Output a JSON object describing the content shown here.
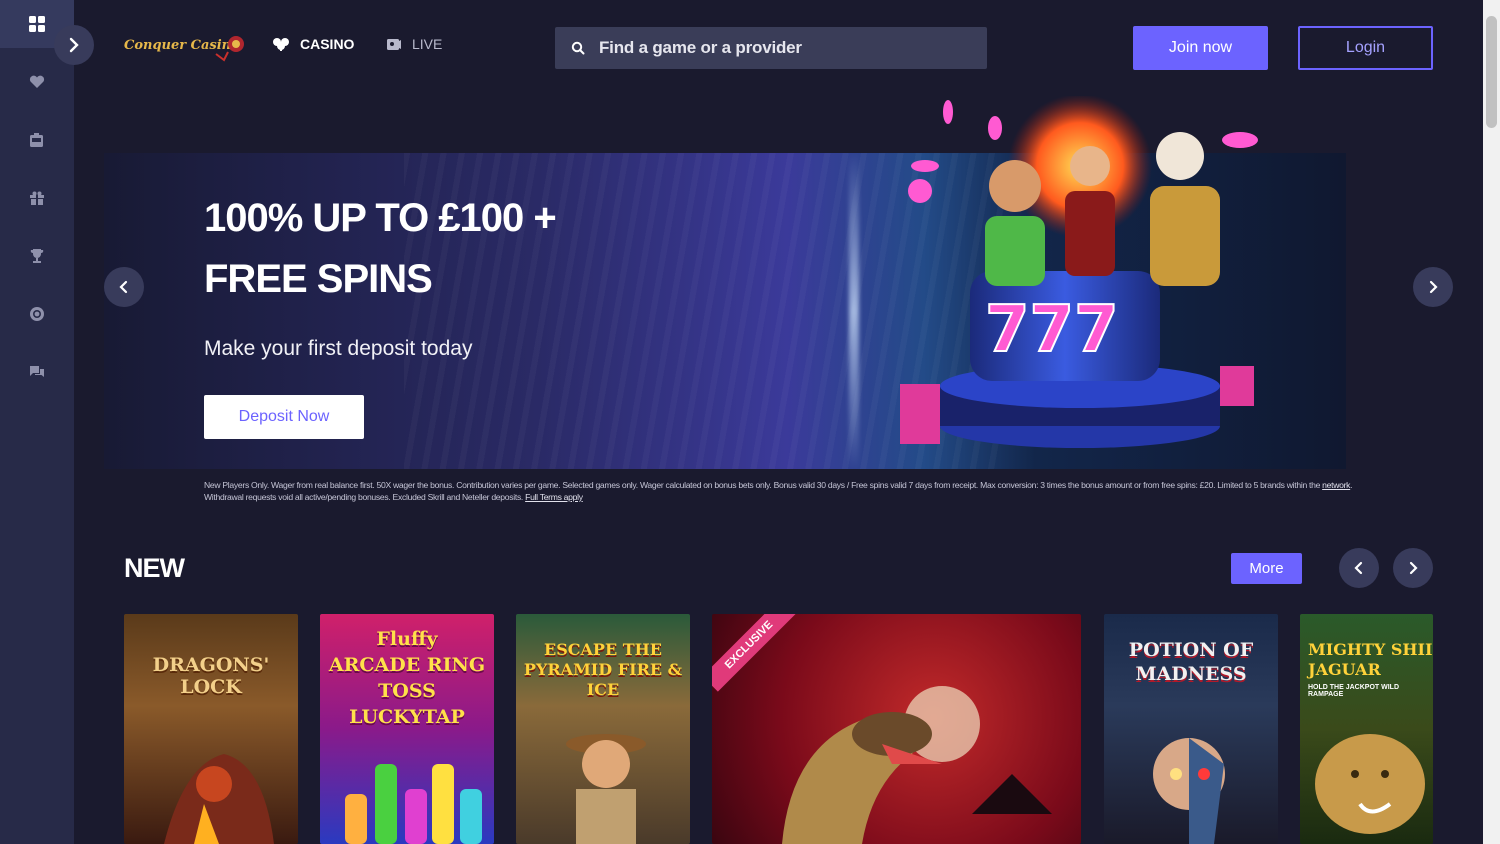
{
  "brand": {
    "name": "Conquer Casino",
    "accent": "#6c63ff",
    "sidebar_bg": "#272a48",
    "page_bg": "#1a1a2e"
  },
  "sidebar": {
    "items": [
      {
        "icon": "grid-icon",
        "active": true
      },
      {
        "icon": "heart-icon"
      },
      {
        "icon": "slot-machine-icon"
      },
      {
        "icon": "gift-icon"
      },
      {
        "icon": "trophy-icon"
      },
      {
        "icon": "chip-icon"
      },
      {
        "icon": "support-chat-icon"
      }
    ]
  },
  "header": {
    "nav": {
      "casino": "CASINO",
      "live": "LIVE"
    },
    "search_placeholder": "Find a game or a provider",
    "join_label": "Join now",
    "login_label": "Login"
  },
  "banner": {
    "title": "100% UP TO £100 + FREE SPINS",
    "subtitle": "Make your first deposit today",
    "cta": "Deposit Now",
    "terms_text": "New Players Only. Wager from real balance first. 50X wager the bonus. Contribution varies per game. Selected games only. Wager calculated on bonus bets only. Bonus valid 30 days / Free spins valid 7 days from receipt. Max conversion: 3 times the bonus amount or from free spins: £20. Limited to 5 brands within the",
    "terms_link1": "network",
    "terms_text2": ". Withdrawal requests void all active/pending bonuses. Excluded Skrill and Neteller deposits.",
    "terms_link2": "Full Terms apply"
  },
  "new_section": {
    "title": "NEW",
    "more_label": "More",
    "games": [
      {
        "title": "DRAGONS' LOCK"
      },
      {
        "title": "Fluffy ARCADE RING TOSS LUCKYTAP"
      },
      {
        "title": "ESCAPE THE PYRAMID FIRE & ICE"
      },
      {
        "title": "EXCLUSIVE",
        "badge": "EXCLUSIVE"
      },
      {
        "title": "POTION OF MADNESS"
      },
      {
        "title": "MIGHTY SHII JAGUAR",
        "subtitle": "HOLD THE JACKPOT WILD RAMPAGE"
      }
    ]
  }
}
